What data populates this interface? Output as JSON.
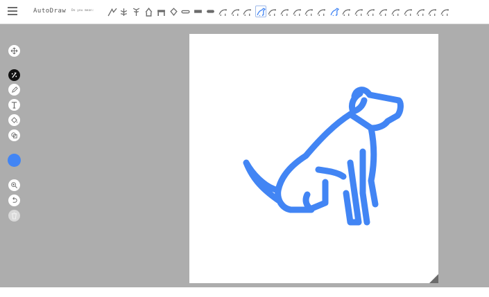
{
  "toolbar": {
    "app_title": "AutoDraw",
    "did_you_mean": "Do you mean:",
    "suggestions": [
      "bird",
      "plant",
      "plant",
      "house",
      "bench",
      "crystal",
      "bench",
      "bench",
      "bench",
      "animal",
      "animal",
      "animal",
      "dog",
      "animal",
      "animal",
      "animal",
      "animal",
      "animal",
      "dog",
      "animal",
      "animal",
      "animal",
      "animal",
      "animal",
      "animal",
      "animal",
      "animal",
      "animal"
    ]
  },
  "colors": {
    "workspace": "#adadad",
    "canvas": "#ffffff",
    "stroke": "#4285f4",
    "icon": "#6b6b6b"
  },
  "tools": [
    "move-icon",
    "autodraw-icon",
    "draw-icon",
    "type-icon",
    "fill-icon",
    "shape-icon",
    "zoom-icon",
    "undo-icon",
    "delete-icon"
  ],
  "selected_tool": "autodraw-icon",
  "current_color": "#4285f4"
}
